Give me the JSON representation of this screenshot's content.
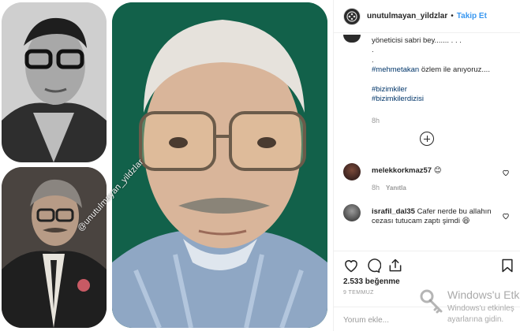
{
  "post": {
    "username": "unutulmayan_yildzlar",
    "separator": "•",
    "follow_label": "Takip Et",
    "image_watermark": "@unutulmayan_yildzlar"
  },
  "caption": {
    "lines": [
      "yöneticisi sabri bey....... . . .",
      ".",
      "."
    ],
    "tags": [
      "#mehmetakan",
      "#bizimkiler",
      "#bizimkilerdizisi"
    ],
    "tag_suffix": " özlem ile anıyoruz....",
    "time": "8h"
  },
  "comments": [
    {
      "user": "melekkorkmaz57",
      "text": "😊",
      "time": "8h",
      "reply_label": "Yanıtla"
    },
    {
      "user": "israfil_dal35",
      "text": "Cafer nerde bu allahın cezası tutucam zaptı şimdi 😆"
    }
  ],
  "actions": {
    "likes": "2.533 beğenme",
    "date": "9 TEMMUZ",
    "comment_placeholder": "Yorum ekle..."
  },
  "windows_watermark": {
    "title": "Windows'u Etk",
    "line1": "Windows'u etkinleş",
    "line2": "ayarlarına gidin."
  },
  "icons": {
    "header_avatar": "film-reel-logo",
    "add_comment": "plus-circle-icon",
    "like": "heart-icon",
    "comment": "comment-bubble-icon",
    "share": "share-arrow-icon",
    "save": "bookmark-icon"
  }
}
